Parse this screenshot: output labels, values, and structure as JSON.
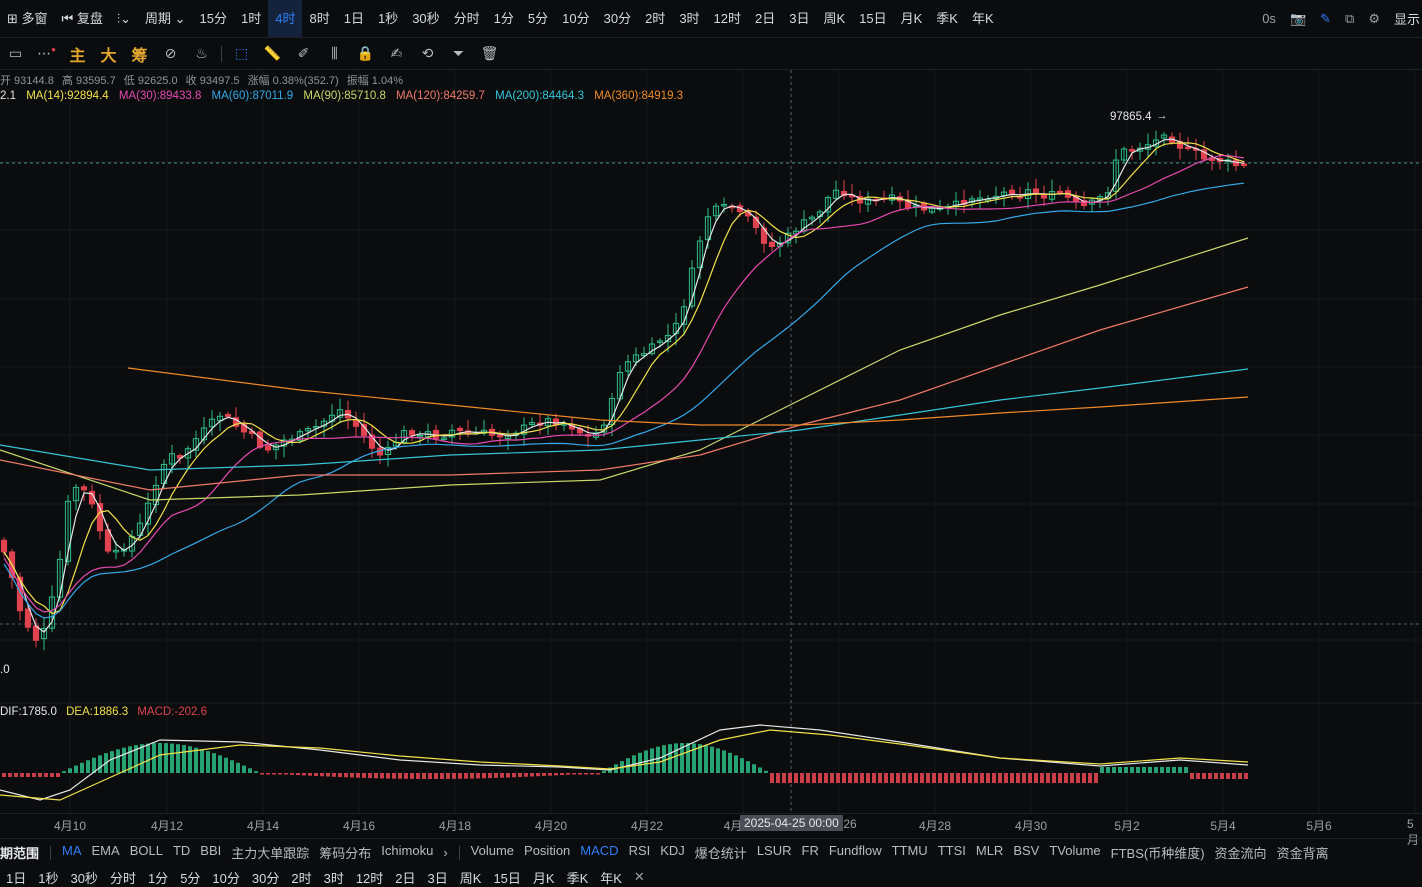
{
  "topbar": {
    "multi_window": "多窗",
    "adjust": "复盘",
    "period_menu": "周期",
    "periods": [
      "15分",
      "1时",
      "4时",
      "8时",
      "1日",
      "1秒",
      "30秒",
      "分时",
      "1分",
      "5分",
      "10分",
      "30分",
      "2时",
      "3时",
      "12时",
      "2日",
      "3日",
      "周K",
      "15日",
      "月K",
      "季K",
      "年K"
    ],
    "active_period": "4时",
    "seconds": "0s",
    "display": "显示"
  },
  "toolbar": {
    "indicators": [
      "主",
      "大",
      "筹"
    ]
  },
  "ohlc": {
    "open": "开 93144.8",
    "high": "高 93595.7",
    "low": "低 92625.0",
    "close": "收 93497.5",
    "change": "涨幅 0.38%(352.7)",
    "amplitude": "振幅 1.04%"
  },
  "ma_legend": {
    "ma7_cut": "2.1",
    "ma14": "MA(14):92894.4",
    "ma30": "MA(30):89433.8",
    "ma60": "MA(60):87011.9",
    "ma90": "MA(90):85710.8",
    "ma120": "MA(120):84259.7",
    "ma200": "MA(200):84464.3",
    "ma360": "MA(360):84919.3"
  },
  "colors": {
    "up": "#2ebd85",
    "down": "#e0434f",
    "ma7": "#e6e6e6",
    "ma14": "#f0e04a",
    "ma30": "#e64ab0",
    "ma60": "#34a8e8",
    "ma90": "#c8d86a",
    "ma120": "#f07a6a",
    "ma200": "#36c6d6",
    "ma360": "#f08a2a",
    "accent": "#2f7df6"
  },
  "price_annotation": "97865.4",
  "low_annotation": ".0",
  "macd_legend": {
    "dif": "DIF:1785.0",
    "dea": "DEA:1886.3",
    "macd": "MACD:-202.6"
  },
  "x_axis_labels": [
    "4月10",
    "4月12",
    "4月14",
    "4月16",
    "4月18",
    "4月20",
    "4月22",
    "4月",
    "26",
    "4月28",
    "4月30",
    "5月2",
    "5月4",
    "5月6",
    "5月"
  ],
  "crosshair_time": "2025-04-25 00:00",
  "indicator_tabs": {
    "left_label": "期范围",
    "main": [
      "MA",
      "EMA",
      "BOLL",
      "TD",
      "BBI",
      "主力大单跟踪",
      "筹码分布",
      "Ichimoku"
    ],
    "more": "›",
    "sub": [
      "Volume",
      "Position",
      "MACD",
      "RSI",
      "KDJ",
      "爆仓统计",
      "LSUR",
      "FR",
      "Fundflow",
      "TTMU",
      "TTSI",
      "MLR",
      "BSV",
      "TVolume",
      "FTBS(币种维度)",
      "资金流向",
      "资金背离"
    ],
    "active_main": "MA",
    "active_sub": "MACD"
  },
  "period_bar": {
    "items": [
      "1日",
      "1秒",
      "30秒",
      "分时",
      "1分",
      "5分",
      "10分",
      "30分",
      "2时",
      "3时",
      "12时",
      "2日",
      "3日",
      "周K",
      "15日",
      "月K",
      "季K",
      "年K"
    ],
    "close": "✕"
  },
  "chart_data": {
    "type": "candlestick",
    "y_range": [
      74000,
      100000
    ],
    "annotations": [
      "97865.4"
    ],
    "description_keys": "x = candle index (4h), values read approximately"
  }
}
